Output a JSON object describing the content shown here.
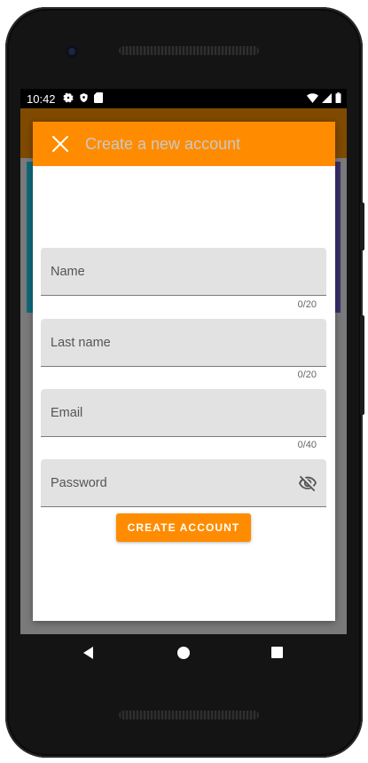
{
  "status_bar": {
    "time": "10:42",
    "left_icons": [
      "gear-icon",
      "shield-icon",
      "sd-card-icon"
    ],
    "right_icons": [
      "wifi-icon",
      "signal-icon",
      "battery-icon"
    ]
  },
  "dialog": {
    "title": "Create a new account",
    "close_icon": "close-icon",
    "header_color": "#ff8c00",
    "fields": [
      {
        "label": "Name",
        "value": "",
        "counter": "0/20"
      },
      {
        "label": "Last name",
        "value": "",
        "counter": "0/20"
      },
      {
        "label": "Email",
        "value": "",
        "counter": "0/40"
      },
      {
        "label": "Password",
        "value": "",
        "visibility_icon": "eye-off-icon"
      }
    ],
    "submit_label": "CREATE ACCOUNT",
    "accent_color": "#ff8c00"
  },
  "nav_bar": {
    "buttons": [
      "back-icon",
      "home-icon",
      "recents-icon"
    ]
  }
}
